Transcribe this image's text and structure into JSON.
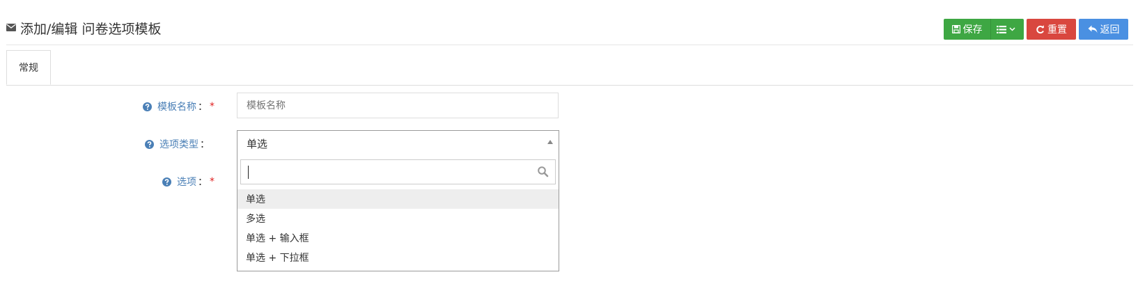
{
  "header": {
    "icon": "envelope-icon",
    "title": "添加/编辑 问卷选项模板"
  },
  "toolbar": {
    "save_label": "保存",
    "reset_label": "重置",
    "back_label": "返回",
    "colors": {
      "save": "#3ea743",
      "reset": "#d9473f",
      "back": "#4a90e2"
    }
  },
  "tabs": [
    {
      "label": "常规",
      "active": true
    }
  ],
  "form": {
    "template_name": {
      "label": "模板名称",
      "colon": "：",
      "required": "*",
      "placeholder": "模板名称",
      "value": ""
    },
    "option_type": {
      "label": "选项类型",
      "colon": "：",
      "selected": "单选"
    },
    "options": {
      "label": "选项",
      "colon": "：",
      "required": "*"
    }
  },
  "dropdown": {
    "search_value": "",
    "items": [
      "单选",
      "多选",
      "单选 + 输入框",
      "单选 + 下拉框"
    ],
    "highlighted_index": 0
  }
}
